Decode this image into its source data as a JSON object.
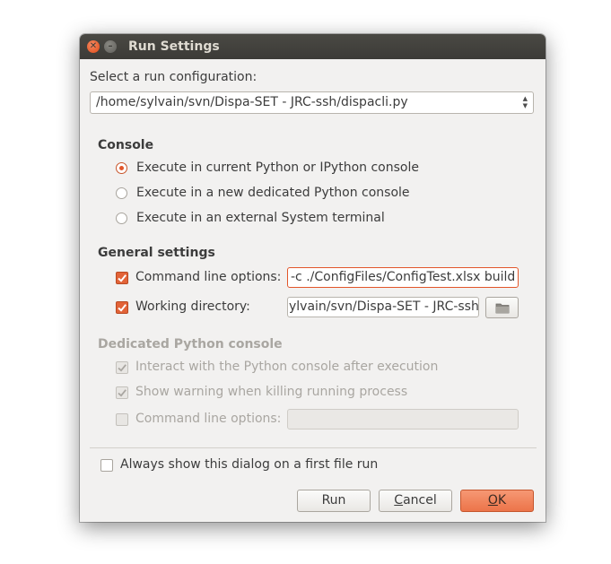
{
  "window": {
    "title": "Run Settings"
  },
  "run_config": {
    "label": "Select a run configuration:",
    "selected": "/home/sylvain/svn/Dispa-SET - JRC-ssh/dispacli.py"
  },
  "console": {
    "heading": "Console",
    "options": [
      {
        "label": "Execute in current Python or IPython console",
        "selected": true
      },
      {
        "label": "Execute in a new dedicated Python console",
        "selected": false
      },
      {
        "label": "Execute in an external System terminal",
        "selected": false
      }
    ]
  },
  "general": {
    "heading": "General settings",
    "cmd_label": "Command line options:",
    "cmd_value": "-c ./ConfigFiles/ConfigTest.xlsx build",
    "wd_label": "Working directory:",
    "wd_value": "ylvain/svn/Dispa-SET - JRC-ssh"
  },
  "dedicated": {
    "heading": "Dedicated Python console",
    "interact_label": "Interact with the Python console after execution",
    "warning_label": "Show warning when killing running process",
    "cmd_label": "Command line options:",
    "cmd_value": ""
  },
  "footer": {
    "always_show_label": "Always show this dialog on a first file run",
    "run_label": "Run",
    "cancel_label": "Cancel",
    "cancel_mnemonic": "C",
    "cancel_rest": "ancel",
    "ok_label": "OK",
    "ok_mnemonic": "O",
    "ok_rest": "K"
  },
  "icons": {
    "close": "close-icon",
    "minimize": "minimize-icon",
    "folder": "folder-icon",
    "combo_arrows": "updown-arrows-icon"
  },
  "colors": {
    "accent": "#e2562a",
    "titlebar": "#3c3b37",
    "dialog_bg": "#f2f1f0",
    "ok_button": "#ec7449"
  }
}
